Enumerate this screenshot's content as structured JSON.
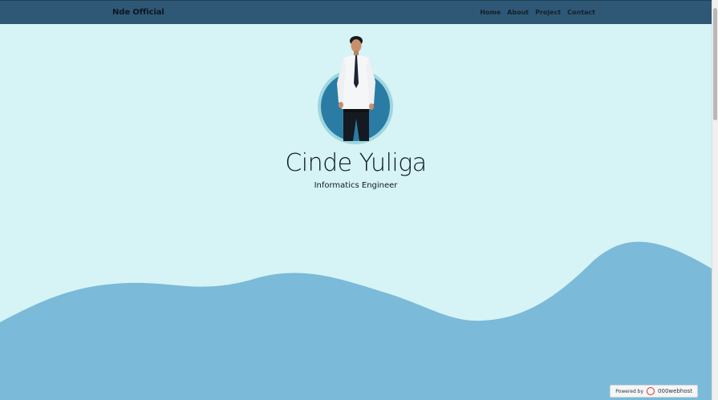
{
  "navbar": {
    "brand": "Nde Official",
    "links": [
      {
        "label": "Home"
      },
      {
        "label": "About"
      },
      {
        "label": "Project"
      },
      {
        "label": "Contact"
      }
    ]
  },
  "hero": {
    "name": "Cinde Yuliga",
    "role": "Informatics Engineer"
  },
  "badge": {
    "powered_by": "Powered by",
    "host": "000webhost"
  },
  "colors": {
    "navbar": "#2f5876",
    "background": "#d6f3f5",
    "wave": "#7bbad8",
    "avatar_ring": "#9ed6df",
    "avatar_inner": "#2a7ca4"
  }
}
